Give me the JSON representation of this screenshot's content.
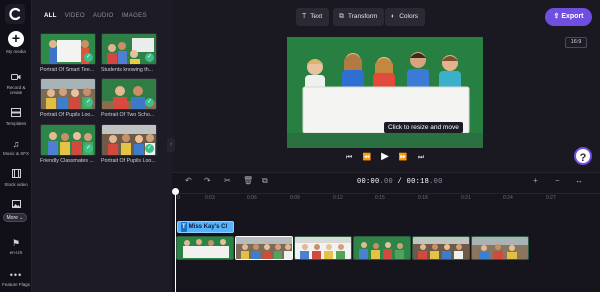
{
  "app": {
    "logo": "clipchamp-logo-icon"
  },
  "sidebar": {
    "items": [
      {
        "label": "My media",
        "icon": "plus-icon"
      },
      {
        "label": "Record & create",
        "icon": "video-camera-icon"
      },
      {
        "label": "Templates",
        "icon": "layers-icon"
      },
      {
        "label": "Music & SFX",
        "icon": "music-note-icon"
      },
      {
        "label": "Stock video",
        "icon": "film-icon"
      },
      {
        "label": "",
        "icon": "image-icon"
      },
      {
        "label": "More",
        "icon": "chevron-down-icon"
      },
      {
        "label": "en-US",
        "icon": "flag-icon"
      },
      {
        "label": "Feature Flags",
        "icon": "dots-icon"
      }
    ]
  },
  "media_panel": {
    "tabs": [
      "ALL",
      "VIDEO",
      "AUDIO",
      "IMAGES"
    ],
    "active_tab": "ALL",
    "items": [
      {
        "caption": "Portrait Of Smart Tee..."
      },
      {
        "caption": "Students knowing th..."
      },
      {
        "caption": "Portrait Of Pupils Loo..."
      },
      {
        "caption": "Portrait Of Two Scho..."
      },
      {
        "caption": "Friendly Classmates ..."
      },
      {
        "caption": "Portrait Of Pupils Loo..."
      }
    ]
  },
  "toolbar": {
    "text_label": "Text",
    "transform_label": "Transform",
    "colors_label": "Colors",
    "export_label": "Export"
  },
  "preview": {
    "aspect_ratio": "16:9",
    "tooltip": "Click to resize and move",
    "help_label": "?"
  },
  "timeline": {
    "current_time": "00:00",
    "current_frac": ".00",
    "total_time": "00:18",
    "total_frac": ".00",
    "ruler": [
      "0",
      "0:03",
      "0:06",
      "0:09",
      "0:12",
      "0:15",
      "0:18",
      "0:21",
      "0:24",
      "0:27"
    ],
    "text_clip_label": "Miss Kay's Cl",
    "zoom_in_label": "+",
    "zoom_out_label": "−"
  },
  "colors": {
    "accent": "#6f4ee0",
    "check": "#3bbf8b",
    "text_clip": "#55b3ff",
    "board_green": "#247a3d"
  }
}
